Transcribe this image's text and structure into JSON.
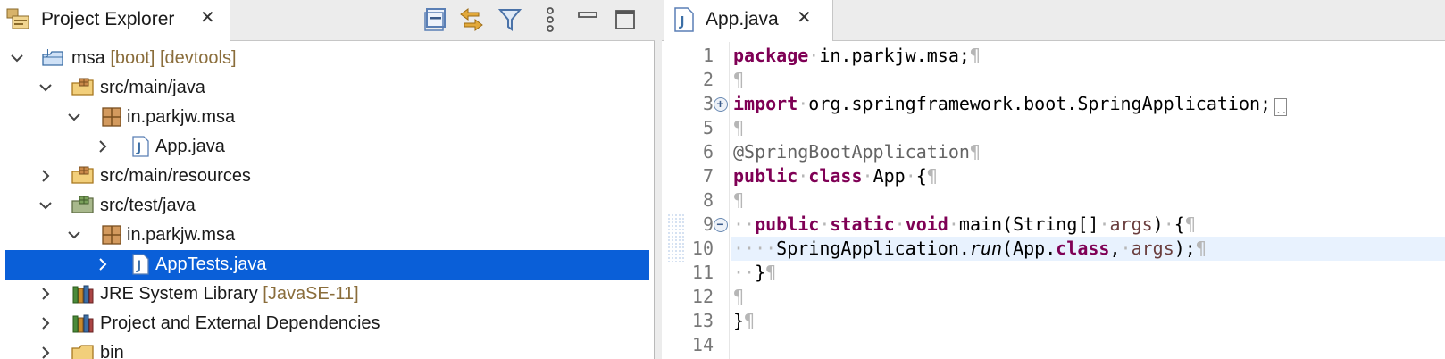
{
  "explorer": {
    "tab_title": "Project Explorer",
    "tab_close": "✕",
    "toolbar": [
      "collapse-all",
      "link-with-editor",
      "filter",
      "view-menu",
      "minimize",
      "maximize"
    ],
    "tree": [
      {
        "label": "msa",
        "deco": " [boot] [devtools]",
        "depth": 0,
        "expanded": true,
        "icon": "project-icon"
      },
      {
        "label": "src/main/java",
        "deco": "",
        "depth": 1,
        "expanded": true,
        "icon": "source-folder-icon"
      },
      {
        "label": "in.parkjw.msa",
        "deco": "",
        "depth": 2,
        "expanded": true,
        "icon": "package-icon"
      },
      {
        "label": "App.java",
        "deco": "",
        "depth": 3,
        "expanded": false,
        "icon": "java-file-icon"
      },
      {
        "label": "src/main/resources",
        "deco": "",
        "depth": 1,
        "expanded": false,
        "icon": "source-folder-icon"
      },
      {
        "label": "src/test/java",
        "deco": "",
        "depth": 1,
        "expanded": true,
        "icon": "test-folder-icon"
      },
      {
        "label": "in.parkjw.msa",
        "deco": "",
        "depth": 2,
        "expanded": true,
        "icon": "package-icon"
      },
      {
        "label": "AppTests.java",
        "deco": "",
        "depth": 3,
        "expanded": false,
        "icon": "java-file-icon",
        "selected": true
      },
      {
        "label": "JRE System Library",
        "deco": " [JavaSE-11]",
        "depth": 1,
        "expanded": false,
        "icon": "library-icon"
      },
      {
        "label": "Project and External Dependencies",
        "deco": "",
        "depth": 1,
        "expanded": false,
        "icon": "library-icon"
      },
      {
        "label": "bin",
        "deco": "",
        "depth": 1,
        "expanded": false,
        "icon": "folder-icon"
      }
    ]
  },
  "editor": {
    "tab_title": "App.java",
    "tab_close": "✕",
    "current_line": 10,
    "lines": [
      {
        "n": "1",
        "tokens": [
          [
            "kw",
            "package"
          ],
          [
            "ws",
            "·"
          ],
          [
            "t",
            "in.parkjw.msa;"
          ],
          [
            "ws",
            "¶"
          ]
        ]
      },
      {
        "n": "2",
        "tokens": [
          [
            "ws",
            "¶"
          ]
        ]
      },
      {
        "n": "3",
        "fold": "+",
        "tokens": [
          [
            "kw",
            "import"
          ],
          [
            "ws",
            "·"
          ],
          [
            "t",
            "org.springframework.boot.SpringApplication;"
          ],
          [
            "box",
            ".."
          ]
        ]
      },
      {
        "n": "5",
        "tokens": [
          [
            "ws",
            "¶"
          ]
        ]
      },
      {
        "n": "6",
        "tokens": [
          [
            "ann",
            "@SpringBootApplication"
          ],
          [
            "ws",
            "¶"
          ]
        ]
      },
      {
        "n": "7",
        "tokens": [
          [
            "kw",
            "public"
          ],
          [
            "ws",
            "·"
          ],
          [
            "kw",
            "class"
          ],
          [
            "ws",
            "·"
          ],
          [
            "t",
            "App"
          ],
          [
            "ws",
            "·"
          ],
          [
            "t",
            "{"
          ],
          [
            "ws",
            "¶"
          ]
        ]
      },
      {
        "n": "8",
        "tokens": [
          [
            "ws",
            "¶"
          ]
        ]
      },
      {
        "n": "9",
        "fold": "−",
        "tokens": [
          [
            "ws",
            "··"
          ],
          [
            "kw",
            "public"
          ],
          [
            "ws",
            "·"
          ],
          [
            "kw",
            "static"
          ],
          [
            "ws",
            "·"
          ],
          [
            "kw",
            "void"
          ],
          [
            "ws",
            "·"
          ],
          [
            "t",
            "main(String[]"
          ],
          [
            "ws",
            "·"
          ],
          [
            "var",
            "args"
          ],
          [
            "t",
            ")"
          ],
          [
            "ws",
            "·"
          ],
          [
            "t",
            "{"
          ],
          [
            "ws",
            "¶"
          ]
        ]
      },
      {
        "n": "10",
        "tokens": [
          [
            "ws",
            "····"
          ],
          [
            "t",
            "SpringApplication."
          ],
          [
            "it",
            "run"
          ],
          [
            "t",
            "(App."
          ],
          [
            "kw",
            "class"
          ],
          [
            "t",
            ","
          ],
          [
            "ws",
            "·"
          ],
          [
            "var",
            "args"
          ],
          [
            "t",
            ");"
          ],
          [
            "ws",
            "¶"
          ]
        ]
      },
      {
        "n": "11",
        "tokens": [
          [
            "ws",
            "··"
          ],
          [
            "t",
            "}"
          ],
          [
            "ws",
            "¶"
          ]
        ]
      },
      {
        "n": "12",
        "tokens": [
          [
            "ws",
            "¶"
          ]
        ]
      },
      {
        "n": "13",
        "tokens": [
          [
            "t",
            "}"
          ],
          [
            "ws",
            "¶"
          ]
        ]
      },
      {
        "n": "14",
        "tokens": []
      }
    ]
  },
  "colors": {
    "selection": "#0a5fd8",
    "keyword": "#7f0055",
    "annotation": "#646464",
    "whitespace_marker": "#b6b6b6",
    "decoration": "#8a6d3b",
    "current_line": "#e8f2fe"
  }
}
